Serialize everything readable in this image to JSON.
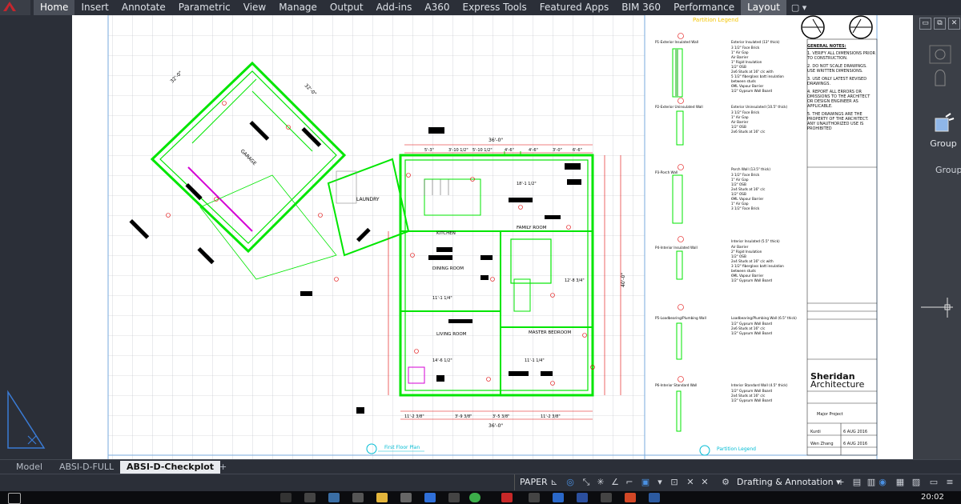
{
  "ribbon": {
    "tabs": [
      "Home",
      "Insert",
      "Annotate",
      "Parametric",
      "View",
      "Manage",
      "Output",
      "Add-ins",
      "A360",
      "Express Tools",
      "Featured Apps",
      "BIM 360",
      "Performance",
      "Layout"
    ],
    "active_tab": "Home",
    "extra": "▢ ▾"
  },
  "viewport": {
    "legend_title": "Partition Legend",
    "floor_plan_caption": "First Floor Plan",
    "partition_caption": "Partition Legend",
    "dim_total_top": "36'-0\"",
    "dim_total_bottom": "36'-0\"",
    "dim_left_angled": "32'-0\"",
    "dim_right": "40'-0\"",
    "dim_top_segments": [
      "5'-3\"",
      "3'-10 1/2\"",
      "5'-10 1/2\"",
      "4'-6\"",
      "4'-6\"",
      "3'-0\"",
      "6'-6\""
    ],
    "dim_bottom_segments": [
      "11'-2 3/8\"",
      "3'-9 3/8\"",
      "3'-5 3/8\"",
      "11'-2 3/8\""
    ],
    "rooms": [
      "LAUNDRY",
      "KITCHEN",
      "FAMILY ROOM",
      "DINING ROOM",
      "LIVING ROOM",
      "MASTER BEDROOM",
      "GARAGE"
    ],
    "room_dims": [
      "18'-1 1/2\"",
      "11'-1 1/4\"",
      "14'-6 1/2\"",
      "11'-1 1/4\"",
      "12'-8 3/4\""
    ]
  },
  "legend": {
    "walls": [
      {
        "tag": "P1",
        "title": "P1-Exterior Insulated Wall",
        "desc": "Exterior Insulated (13\" thick)",
        "layers": [
          "3 1/2\"  Face Brick",
          "1\"  Air Gap",
          "  Air Barrier",
          "1\"  Rigid Insulation",
          "1/2\"  OSB",
          "2x6  Studs at 16\" c/c with",
          "  5 1/2\" fiberglass batt insulation",
          "  between studs",
          "6ML  Vapour Barrier",
          "1/2\"  Gypsum Wall Board"
        ]
      },
      {
        "tag": "P2",
        "title": "P2-Exterior Uninsulated Wall",
        "desc": "Exterior Uninsulated (10.5\" thick)",
        "layers": [
          "3 1/2\"  Face Brick",
          "1\"  Air Gap",
          "  Air Barrier",
          "1/2\"  OSB",
          "2x6  Studs at 16\" c/c"
        ]
      },
      {
        "tag": "P3",
        "title": "P3-Porch Wall",
        "desc": "Porch Wall (13.5\" thick)",
        "layers": [
          "3 1/2\"  Face Brick",
          "1\"  Air Gap",
          "1/2\"  OSB",
          "2x4  Studs at 16\" c/c",
          "1/2\"  OSB",
          "6ML  Vapour Barrier",
          "1\"  Air Gap",
          "3 1/2\"  Face Brick"
        ]
      },
      {
        "tag": "P4",
        "title": "P4-Interior Insulated Wall",
        "desc": "Interior Insulated (5.5\" thick)",
        "layers": [
          "  Air Barrier",
          "2\"  Rigid Insulation",
          "1/2\"  OSB",
          "2x4  Studs at 16\" c/c with",
          "  3 1/2\" fiberglass batt insulation",
          "  between studs",
          "6ML  Vapour Barrier",
          "1/2\"  Gypsum Wall Board"
        ]
      },
      {
        "tag": "P5",
        "title": "P5-Loadbearing/Plumbing Wall",
        "desc": "Loadbearing/Plumbing Wall (6.5\" thick)",
        "layers": [
          "1/2\"  Gypsum Wall Board",
          "2x6  Studs at 16\" c/c",
          "1/2\"  Gypsum Wall Board"
        ]
      },
      {
        "tag": "P6",
        "title": "P6-Interior Standard Wall",
        "desc": "Interior Standard Wall (4.5\" thick)",
        "layers": [
          "1/2\"  Gypsum Wall Board",
          "2x4  Studs at 16\" c/c",
          "1/2\"  Gypsum Wall Board"
        ]
      }
    ]
  },
  "titleblock": {
    "notes_title": "GENERAL NOTES:",
    "notes": [
      "1. VERIFY ALL DIMENSIONS PRIOR TO CONSTRUCTION.",
      "2. DO NOT SCALE DRAWINGS. USE WRITTEN DIMENSIONS.",
      "3. USE ONLY LATEST REVISED DRAWINGS.",
      "4. REPORT ALL ERRORS OR OMISSIONS TO THE ARCHITECT OR DESIGN ENGINEER AS APPLICABLE.",
      "5. THE DRAWINGS ARE THE PROPERTY OF THE ARCHITECT. ANY UNAUTHORIZED USE IS PROHIBITED"
    ],
    "firm_line1": "Sheridan",
    "firm_line2": "Architecture",
    "project": "Major Project",
    "drawn_by": "Kurdi",
    "drawn_date": "6 AUG 2016",
    "checked_by": "Wen Zhang",
    "checked_date": "6 AUG 2016"
  },
  "right_panel": {
    "group_label": "Group",
    "group_label2": "Group",
    "window_controls": [
      "▭",
      "⧉",
      "✕"
    ]
  },
  "layout_tabs": [
    "Model",
    "ABSI-D-FULL",
    "ABSI-D-Checkplot",
    "+"
  ],
  "active_layout_tab": "ABSI-D-Checkplot",
  "statusbar": {
    "paper": "PAPER",
    "workspace": "Drafting & Annotation",
    "workspace_arrow": "▾"
  },
  "taskbar": {
    "clock": "20:02"
  },
  "colors": {
    "wall_green": "#00e600",
    "red_marks": "#e00000",
    "magenta": "#d400d4",
    "grid": "#b9bcc4",
    "cyan": "#00bcd4"
  }
}
